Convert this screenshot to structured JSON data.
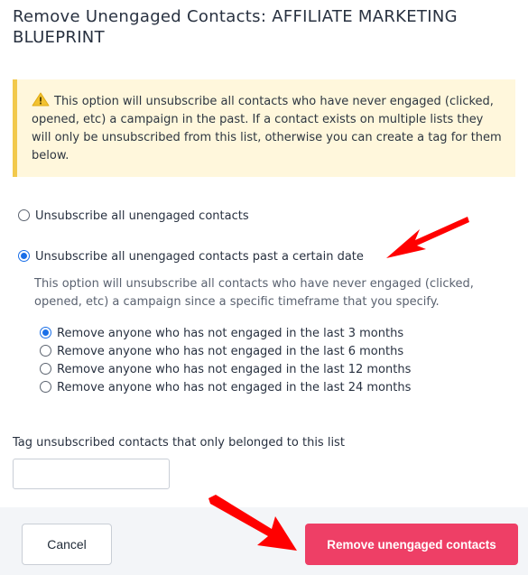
{
  "dialog": {
    "title": "Remove Unengaged Contacts: AFFILIATE MARKETING BLUEPRINT",
    "warning_icon": "warning-triangle-icon",
    "warning_text": "This option will unsubscribe all contacts who have never engaged (clicked, opened, etc) a campaign in the past. If a contact exists on multiple lists they will only be unsubscribed from this list, otherwise you can create a tag for them below."
  },
  "options": {
    "all_label": "Unsubscribe all unengaged contacts",
    "past_date_label": "Unsubscribe all unengaged contacts past a certain date",
    "selected": "past_date",
    "past_date_description": "This option will unsubscribe all contacts who have never engaged (clicked, opened, etc) a campaign since a specific timeframe that you specify."
  },
  "timeframes": [
    {
      "label": "Remove anyone who has not engaged in the last 3 months",
      "checked": true
    },
    {
      "label": "Remove anyone who has not engaged in the last 6 months",
      "checked": false
    },
    {
      "label": "Remove anyone who has not engaged in the last 12 months",
      "checked": false
    },
    {
      "label": "Remove anyone who has not engaged in the last 24 months",
      "checked": false
    }
  ],
  "tag": {
    "label": "Tag unsubscribed contacts that only belonged to this list",
    "value": ""
  },
  "footer": {
    "cancel_label": "Cancel",
    "remove_label": "Remove unengaged contacts"
  },
  "colors": {
    "primary_button": "#ee3f66",
    "radio_selected": "#1a6fe8",
    "alert_background": "#fff7dc",
    "alert_border": "#f2c94c",
    "annotation_arrow": "#ff0000"
  }
}
